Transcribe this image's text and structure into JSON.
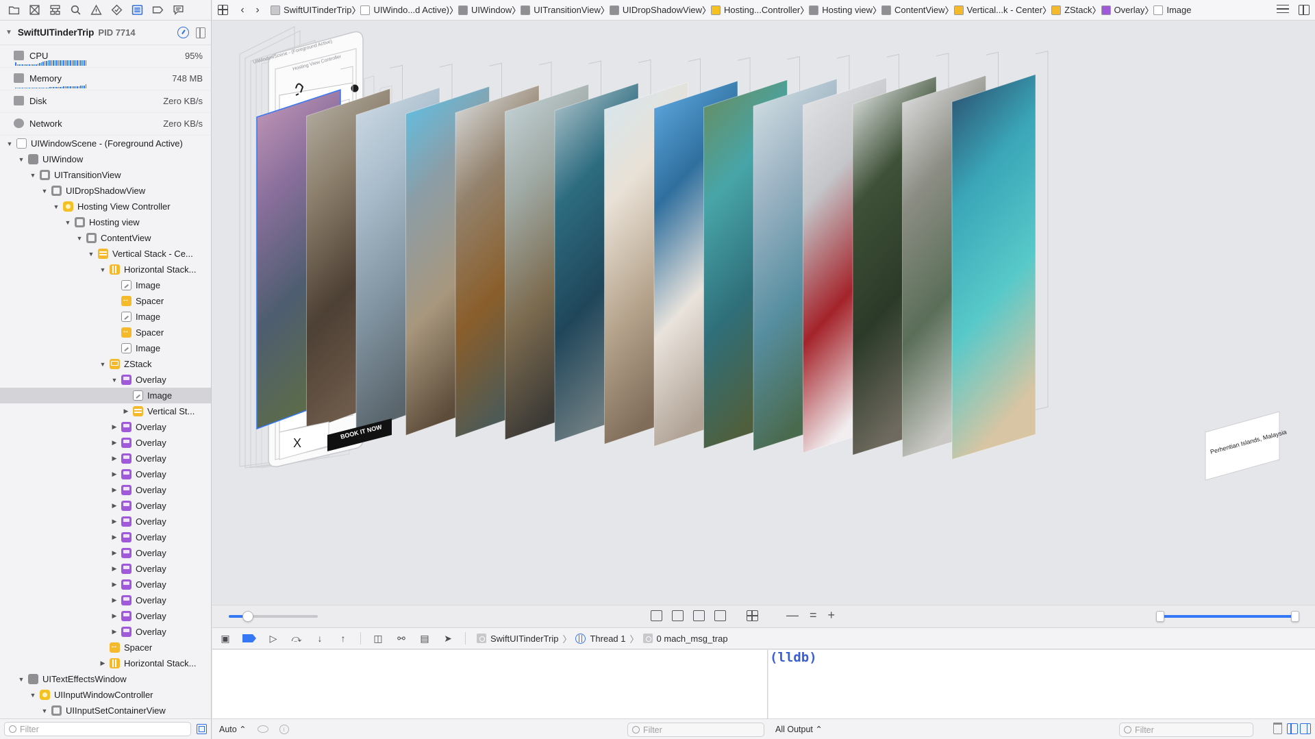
{
  "process": {
    "name": "SwiftUITinderTrip",
    "pid": "PID 7714"
  },
  "gauges": [
    {
      "label": "CPU",
      "value": "95%",
      "icon": "cpu-icon"
    },
    {
      "label": "Memory",
      "value": "748 MB",
      "icon": "memory-icon"
    },
    {
      "label": "Disk",
      "value": "Zero KB/s",
      "icon": "disk-icon"
    },
    {
      "label": "Network",
      "value": "Zero KB/s",
      "icon": "network-icon"
    }
  ],
  "tree": [
    {
      "label": "UIWindowScene - (Foreground Active)",
      "depth": 0,
      "disc": "open",
      "icon": "scene"
    },
    {
      "label": "UIWindow",
      "depth": 1,
      "disc": "open",
      "icon": "window"
    },
    {
      "label": "UITransitionView",
      "depth": 2,
      "disc": "open",
      "icon": "view"
    },
    {
      "label": "UIDropShadowView",
      "depth": 3,
      "disc": "open",
      "icon": "view"
    },
    {
      "label": "Hosting View Controller",
      "depth": 4,
      "disc": "open",
      "icon": "ctrl"
    },
    {
      "label": "Hosting view",
      "depth": 5,
      "disc": "open",
      "icon": "view"
    },
    {
      "label": "ContentView",
      "depth": 6,
      "disc": "open",
      "icon": "view"
    },
    {
      "label": "Vertical Stack - Ce...",
      "depth": 7,
      "disc": "open",
      "icon": "vstack"
    },
    {
      "label": "Horizontal Stack...",
      "depth": 8,
      "disc": "open",
      "icon": "hstack"
    },
    {
      "label": "Image",
      "depth": 9,
      "disc": "none",
      "icon": "image"
    },
    {
      "label": "Spacer",
      "depth": 9,
      "disc": "none",
      "icon": "spacer"
    },
    {
      "label": "Image",
      "depth": 9,
      "disc": "none",
      "icon": "image"
    },
    {
      "label": "Spacer",
      "depth": 9,
      "disc": "none",
      "icon": "spacer"
    },
    {
      "label": "Image",
      "depth": 9,
      "disc": "none",
      "icon": "image"
    },
    {
      "label": "ZStack",
      "depth": 8,
      "disc": "open",
      "icon": "zstack"
    },
    {
      "label": "Overlay",
      "depth": 9,
      "disc": "open",
      "icon": "overlay"
    },
    {
      "label": "Image",
      "depth": 10,
      "disc": "none",
      "icon": "image",
      "selected": true
    },
    {
      "label": "Vertical St...",
      "depth": 10,
      "disc": "closed",
      "icon": "vstack"
    },
    {
      "label": "Overlay",
      "depth": 9,
      "disc": "closed",
      "icon": "overlay"
    },
    {
      "label": "Overlay",
      "depth": 9,
      "disc": "closed",
      "icon": "overlay"
    },
    {
      "label": "Overlay",
      "depth": 9,
      "disc": "closed",
      "icon": "overlay"
    },
    {
      "label": "Overlay",
      "depth": 9,
      "disc": "closed",
      "icon": "overlay"
    },
    {
      "label": "Overlay",
      "depth": 9,
      "disc": "closed",
      "icon": "overlay"
    },
    {
      "label": "Overlay",
      "depth": 9,
      "disc": "closed",
      "icon": "overlay"
    },
    {
      "label": "Overlay",
      "depth": 9,
      "disc": "closed",
      "icon": "overlay"
    },
    {
      "label": "Overlay",
      "depth": 9,
      "disc": "closed",
      "icon": "overlay"
    },
    {
      "label": "Overlay",
      "depth": 9,
      "disc": "closed",
      "icon": "overlay"
    },
    {
      "label": "Overlay",
      "depth": 9,
      "disc": "closed",
      "icon": "overlay"
    },
    {
      "label": "Overlay",
      "depth": 9,
      "disc": "closed",
      "icon": "overlay"
    },
    {
      "label": "Overlay",
      "depth": 9,
      "disc": "closed",
      "icon": "overlay"
    },
    {
      "label": "Overlay",
      "depth": 9,
      "disc": "closed",
      "icon": "overlay"
    },
    {
      "label": "Overlay",
      "depth": 9,
      "disc": "closed",
      "icon": "overlay"
    },
    {
      "label": "Spacer",
      "depth": 8,
      "disc": "none",
      "icon": "spacer"
    },
    {
      "label": "Horizontal Stack...",
      "depth": 8,
      "disc": "closed",
      "icon": "hstack"
    },
    {
      "label": "UITextEffectsWindow",
      "depth": 1,
      "disc": "open",
      "icon": "window"
    },
    {
      "label": "UIInputWindowController",
      "depth": 2,
      "disc": "open",
      "icon": "ctrl"
    },
    {
      "label": "UIInputSetContainerView",
      "depth": 3,
      "disc": "open",
      "icon": "view"
    }
  ],
  "nav_filter": {
    "placeholder": "Filter"
  },
  "breadcrumbs": [
    {
      "label": "SwiftUITinderTrip",
      "icon": "app-icon",
      "color": "#c7c7cc"
    },
    {
      "label": "UIWindo...d Active)",
      "icon": "scene-icon",
      "color": "#ffffff"
    },
    {
      "label": "UIWindow",
      "icon": "window-icon",
      "color": "#8e8e93"
    },
    {
      "label": "UITransitionView",
      "icon": "view-icon",
      "color": "#8e8e93"
    },
    {
      "label": "UIDropShadowView",
      "icon": "view-icon",
      "color": "#8e8e93"
    },
    {
      "label": "Hosting...Controller",
      "icon": "controller-icon",
      "color": "#f5c022"
    },
    {
      "label": "Hosting view",
      "icon": "view-icon",
      "color": "#8e8e93"
    },
    {
      "label": "ContentView",
      "icon": "view-icon",
      "color": "#8e8e93"
    },
    {
      "label": "Vertical...k - Center",
      "icon": "vstack-icon",
      "color": "#f5b92c"
    },
    {
      "label": "ZStack",
      "icon": "zstack-icon",
      "color": "#f5b92c"
    },
    {
      "label": "Overlay",
      "icon": "overlay-icon",
      "color": "#a05ad9"
    },
    {
      "label": "Image",
      "icon": "image-icon",
      "color": "#ffffff"
    }
  ],
  "canvas": {
    "card_text": {
      "book_button": "BOOK IT NOW",
      "close_x": "X",
      "location_caption": "Perhentian Islands, Malaysia"
    },
    "phone_labels": {
      "scene": "UIWindowScene - (Foreground Active)",
      "controller": "Hosting View Controller"
    },
    "card_palettes": [
      [
        "#c79ab9",
        "#8a6f9c",
        "#4e5d70",
        "#5b6b4c"
      ],
      [
        "#b8b3a8",
        "#8a7d6a",
        "#4d4034",
        "#6d5a4a"
      ],
      [
        "#cfdce6",
        "#a9bccb",
        "#7f929f",
        "#59646b"
      ],
      [
        "#5bc3ea",
        "#8c9da6",
        "#a8977d",
        "#5d4c3a"
      ],
      [
        "#dfe3e6",
        "#93826d",
        "#8a5e2b",
        "#4e5a55"
      ],
      [
        "#c8d7dd",
        "#9fa9a4",
        "#7c6b4f",
        "#3c3a36"
      ],
      [
        "#b9cbd1",
        "#2d6c80",
        "#20465a",
        "#6b7b80"
      ],
      [
        "#d4e7f1",
        "#e9e1d6",
        "#b6a48d",
        "#7f6d5a"
      ],
      [
        "#63aee6",
        "#2f6f9e",
        "#e9e3dc",
        "#b0a295"
      ],
      [
        "#6a8b5a",
        "#47a5a8",
        "#2f6f7a",
        "#4f5f3d"
      ],
      [
        "#d8e3e6",
        "#9db4c4",
        "#568ea0",
        "#4a6a4e"
      ],
      [
        "#e6e6e8",
        "#c4c6ca",
        "#a4232a",
        "#f2eef0"
      ],
      [
        "#eef1f2",
        "#3f5138",
        "#2b3a28",
        "#6f6a5f"
      ],
      [
        "#e8e8ea",
        "#8c8d84",
        "#5a6e58",
        "#c9c8c4"
      ],
      [
        "#2b4a6b",
        "#3aa6b8",
        "#58c9c9",
        "#d7c5a3"
      ]
    ]
  },
  "view_controls": {
    "zoom_out": "—",
    "zoom_reset": "=",
    "zoom_in": "+"
  },
  "debug_bar": {
    "app": "SwiftUITinderTrip",
    "thread": "Thread 1",
    "frame": "0 mach_msg_trap"
  },
  "console": {
    "prompt": "(lldb)"
  },
  "bottom_bar": {
    "auto_label": "Auto ⌃",
    "variables_filter": "Filter",
    "output_label": "All Output ⌃",
    "console_filter": "Filter"
  },
  "colors": {
    "accent": "#3478f6",
    "selection": "#d4d4d8"
  }
}
